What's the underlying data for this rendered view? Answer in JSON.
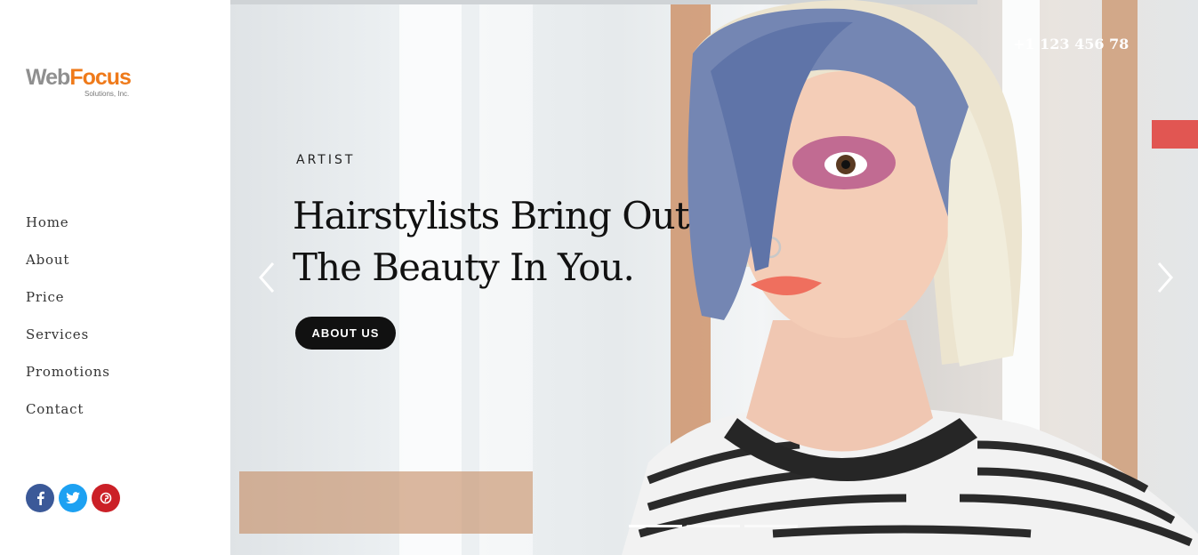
{
  "brand": {
    "name_part1": "Web",
    "name_part2": "Focus",
    "subtitle": "Solutions, Inc."
  },
  "nav": {
    "items": [
      {
        "label": "Home"
      },
      {
        "label": "About"
      },
      {
        "label": "Price"
      },
      {
        "label": "Services"
      },
      {
        "label": "Promotions"
      },
      {
        "label": "Contact"
      }
    ]
  },
  "social": {
    "facebook": {
      "icon": "facebook-icon",
      "glyph": "f",
      "color": "#3b5998"
    },
    "twitter": {
      "icon": "twitter-icon",
      "glyph": "t",
      "color": "#1da1f2"
    },
    "pinterest": {
      "icon": "pinterest-icon",
      "glyph": "p",
      "color": "#cb2027"
    }
  },
  "hero": {
    "phone": "+1 123 456 78",
    "eyebrow": "ARTIST",
    "headline_line1": "Hairstylists Bring Out",
    "headline_line2": "The Beauty In You.",
    "cta_label": "ABOUT US",
    "prev_icon": "chevron-left-icon",
    "next_icon": "chevron-right-icon",
    "slides": 3,
    "active_slide": 1
  }
}
